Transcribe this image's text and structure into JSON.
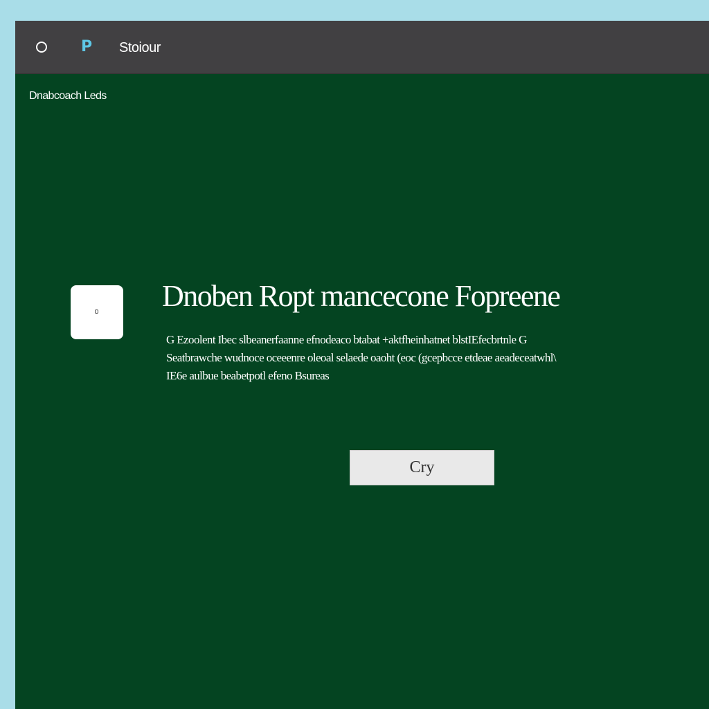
{
  "titlebar": {
    "icon_o": "circle-icon",
    "icon_p": "P",
    "title": "Stoiour"
  },
  "breadcrumb": "Dnabcoach Leds",
  "main": {
    "device_icon": "device-icon",
    "heading": "Dnoben Ropt mancecone Fopreene",
    "description_lines": [
      "G Ezoolent Ibec slbeanerfaanne efnodeaco btabat +aktfheinhatnet blstIEfecbrtnle G",
      "Seatbrawche wudnoce oceeenre oleoal selaede oaoht (eoc (gcepbcce etdeae aeadeceatwhl\\",
      "IE6e aulbue beabetpotl efeno Bsureas"
    ],
    "button_label": "Cry"
  },
  "colors": {
    "background": "#a9dde8",
    "titlebar": "#414042",
    "main": "#044421",
    "accent": "#5ec7e6"
  }
}
